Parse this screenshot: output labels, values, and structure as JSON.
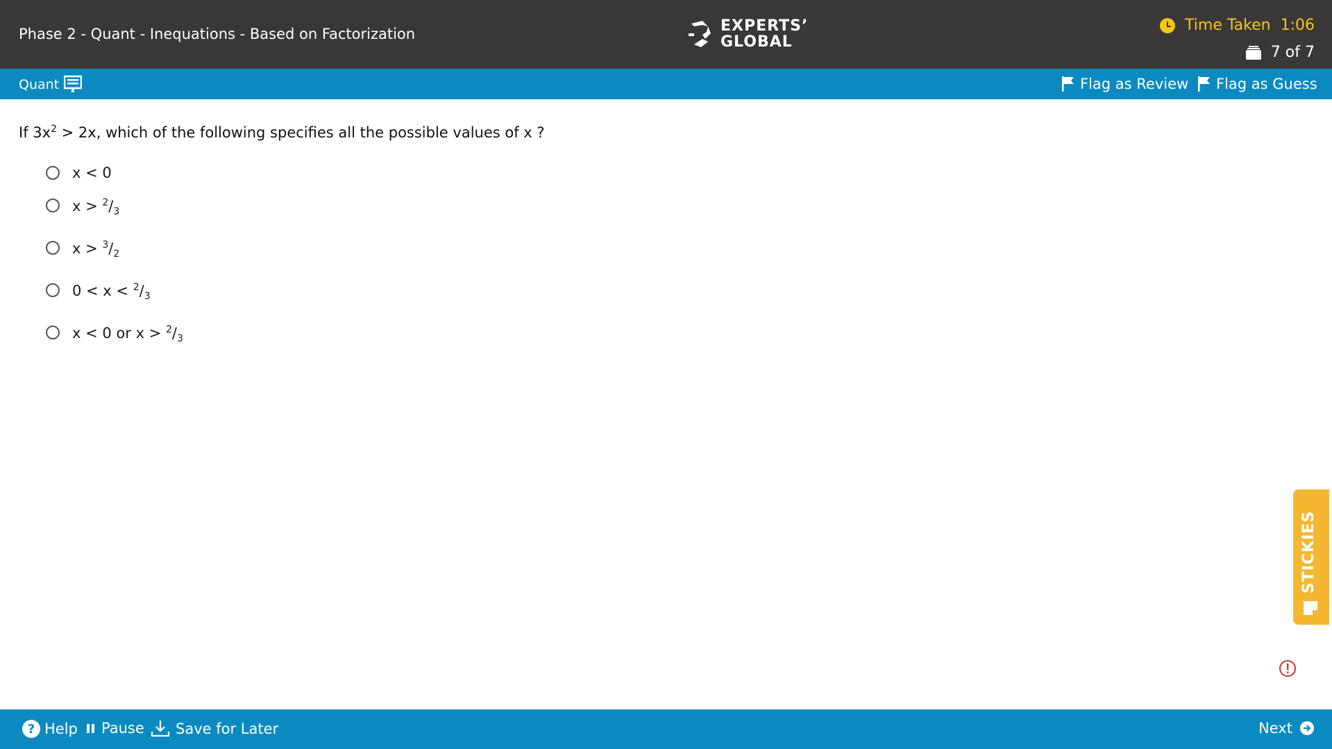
{
  "header": {
    "title": "Phase 2 - Quant - Inequations - Based on Factorization",
    "logo_line1": "EXPERTS’",
    "logo_line2": "GLOBAL",
    "time_label": "Time Taken",
    "time_value": "1:06",
    "question_counter": "7 of 7"
  },
  "section_bar": {
    "section": "Quant",
    "flag_review": "Flag as Review",
    "flag_guess": "Flag as Guess"
  },
  "question": {
    "prefix": "If 3x",
    "exponent": "2",
    "suffix": " > 2x, which of the following specifies all the possible values of x ?"
  },
  "options": [
    {
      "text": "x < 0"
    },
    {
      "text": "x > ",
      "num": "2",
      "den": "3"
    },
    {
      "text": "x > ",
      "num": "3",
      "den": "2"
    },
    {
      "text": "0 < x < ",
      "num": "2",
      "den": "3"
    },
    {
      "text": "x < 0 or x > ",
      "num": "2",
      "den": "3"
    }
  ],
  "stickies": {
    "label": "STICKIES"
  },
  "footer": {
    "help": "Help",
    "pause": "Pause",
    "save": "Save for Later",
    "next": "Next"
  },
  "colors": {
    "header_bg": "#3a3737",
    "bar_blue": "#0b8ac1",
    "timer_yellow": "#f5c518",
    "stickies_orange": "#f5b731",
    "alert_red": "#d9302b"
  }
}
